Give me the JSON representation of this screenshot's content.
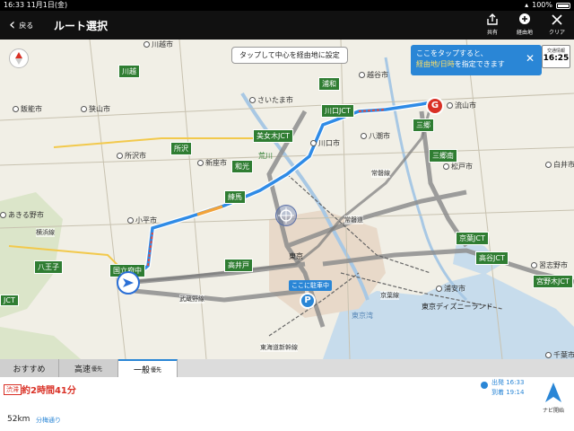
{
  "status": {
    "time": "16:33",
    "date": "11月1日(金)",
    "battery": "100%"
  },
  "nav": {
    "back_label": "戻る",
    "title": "ルート選択",
    "actions": [
      {
        "label": "共有"
      },
      {
        "label": "経由地"
      },
      {
        "label": "クリア"
      }
    ]
  },
  "map": {
    "tip": "タップして中心を経由地に設定",
    "banner": {
      "line1": "ここをタップすると、",
      "line2_highlight": "経由地/日時",
      "line2_rest": "を指定できます"
    },
    "traffic_box": {
      "label": "交通情報",
      "time": "16:25"
    },
    "goal_mark": "G",
    "parking_callout": "ここに駐車中",
    "parking_mark": "P",
    "jcts": [
      "川口JCT",
      "美女木JCT",
      "三郷",
      "三郷南",
      "京葉JCT",
      "高谷JCT",
      "宮野木JCT",
      "浦和",
      "和光",
      "練馬",
      "所沢",
      "川越",
      "八王子",
      "高井戸",
      "国立府中",
      "三郷",
      "JCT"
    ],
    "cities": [
      "川越市",
      "狭山市",
      "飯能市",
      "所沢市",
      "新座市",
      "さいたま市",
      "川口市",
      "越谷市",
      "八潮市",
      "松戸市",
      "流山市",
      "小平市",
      "あきる野市",
      "浦安市",
      "習志野市",
      "白井市",
      "千葉市"
    ],
    "places": [
      "東京",
      "東京湾",
      "東京ディズニーランド"
    ],
    "rails": [
      "常磐線",
      "京葉線",
      "東海道新幹線",
      "武蔵野線",
      "横浜線",
      "常磐道"
    ],
    "rivers": [
      "荒川"
    ]
  },
  "tabs": [
    {
      "label": "おすすめ",
      "suffix": ""
    },
    {
      "label": "高速",
      "suffix": "優先"
    },
    {
      "label": "一般",
      "suffix": "優先"
    }
  ],
  "route": {
    "traffic_badge": "渋滞",
    "duration": "約2時間41分",
    "distance": "52km",
    "road": "分梅通り",
    "depart": "出発 16:33",
    "arrive": "到着 19:14",
    "navi_label": "ナビ開始"
  },
  "colors": {
    "accent": "#2a86d6",
    "route": "#2f8be6",
    "jct": "#2f7d32",
    "warning": "#d93025"
  }
}
